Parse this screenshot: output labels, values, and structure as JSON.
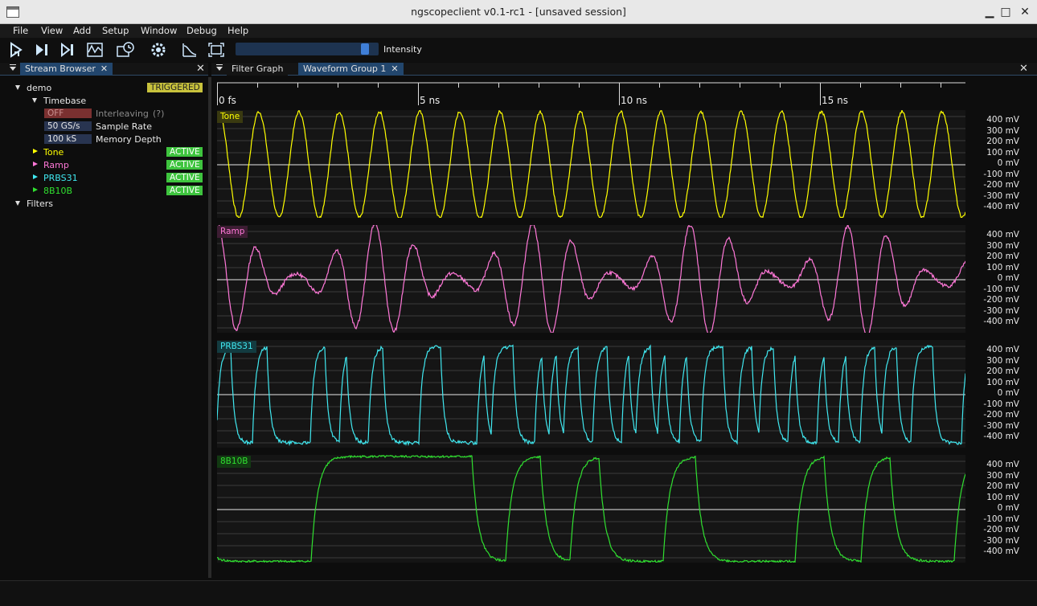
{
  "window": {
    "title": "ngscopeclient v0.1-rc1  - [unsaved session]",
    "minimize": "▁",
    "maximize": "□",
    "close": "✕"
  },
  "menu": [
    "File",
    "View",
    "Add",
    "Setup",
    "Window",
    "Debug",
    "Help"
  ],
  "toolbar": {
    "buttons": [
      "trigger-arm-icon",
      "trigger-single-icon",
      "trigger-force-icon",
      "waveform-icon",
      "history-icon",
      "settings-gear-icon",
      "measure-icon",
      "fullscreen-icon"
    ],
    "intensity_label": "Intensity",
    "intensity_value": 0.94
  },
  "left_panel": {
    "tab": "Stream Browser",
    "instrument": "demo",
    "trigger_status": "TRIGGERED",
    "timebase_label": "Timebase",
    "interleaving_value": "OFF",
    "interleaving_label": "Interleaving",
    "interleaving_help": "(?)",
    "sample_rate_value": "50 GS/s",
    "sample_rate_label": "Sample Rate",
    "memory_depth_value": "100 kS",
    "memory_depth_label": "Memory Depth",
    "channels": [
      {
        "name": "Tone",
        "status": "ACTIVE",
        "color": "#ffff00"
      },
      {
        "name": "Ramp",
        "status": "ACTIVE",
        "color": "#ff78d8"
      },
      {
        "name": "PRBS31",
        "status": "ACTIVE",
        "color": "#40e8f0"
      },
      {
        "name": "8B10B",
        "status": "ACTIVE",
        "color": "#30e030"
      }
    ],
    "filters_label": "Filters"
  },
  "right_panel": {
    "tabs": [
      "Filter Graph",
      "Waveform Group 1"
    ],
    "timeline_labels": [
      "0 fs",
      "5 ns",
      "10 ns",
      "15 ns"
    ]
  },
  "axis_labels": [
    "400 mV",
    "300 mV",
    "200 mV",
    "100 mV",
    "0 mV",
    "-100 mV",
    "-200 mV",
    "-300 mV",
    "-400 mV"
  ],
  "waveforms": [
    {
      "name": "Tone",
      "color": "#ffff00",
      "label_bg": "#3a3a10"
    },
    {
      "name": "Ramp",
      "color": "#ff78d8",
      "label_bg": "#3d1d33"
    },
    {
      "name": "PRBS31",
      "color": "#40e8f0",
      "label_bg": "#133b40"
    },
    {
      "name": "8B10B",
      "color": "#30e030",
      "label_bg": "#123a12"
    }
  ],
  "colors": {
    "triggered": "#c8c23c",
    "active": "#3ec43e",
    "off": "#7a3030"
  }
}
